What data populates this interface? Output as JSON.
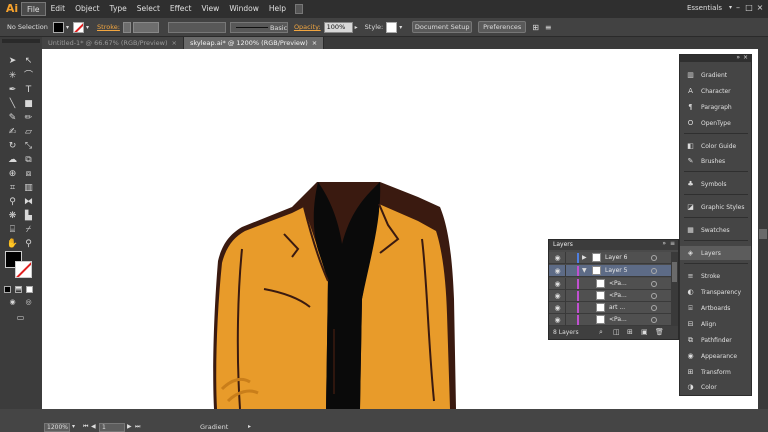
{
  "app": {
    "logo": "Ai"
  },
  "menu": [
    "File",
    "Edit",
    "Object",
    "Type",
    "Select",
    "Effect",
    "View",
    "Window",
    "Help"
  ],
  "workspace": {
    "label": "Essentials"
  },
  "control": {
    "selection": "No Selection",
    "stroke_label": "Stroke:",
    "profile": "Basic",
    "opacity_label": "Opacity:",
    "opacity_value": "100%",
    "style_label": "Style:",
    "doc_setup": "Document Setup",
    "preferences": "Preferences"
  },
  "tabs": [
    {
      "label": "Untitled-1* @ 66.67% (RGB/Preview)",
      "close": "×"
    },
    {
      "label": "skyleap.ai* @ 1200% (RGB/Preview)",
      "close": "×"
    }
  ],
  "status": {
    "zoom": "1200%",
    "page": "1",
    "tool": "Gradient"
  },
  "panels": [
    {
      "label": "Gradient",
      "icon": "gradient-icon"
    },
    {
      "label": "Character",
      "icon": "character-icon"
    },
    {
      "label": "Paragraph",
      "icon": "paragraph-icon"
    },
    {
      "label": "OpenType",
      "icon": "opentype-icon"
    },
    {
      "label": "Color Guide",
      "icon": "color-guide-icon"
    },
    {
      "label": "Brushes",
      "icon": "brushes-icon"
    },
    {
      "label": "Symbols",
      "icon": "symbols-icon"
    },
    {
      "label": "Graphic Styles",
      "icon": "graphic-styles-icon"
    },
    {
      "label": "Swatches",
      "icon": "swatches-icon"
    },
    {
      "label": "Layers",
      "icon": "layers-icon"
    },
    {
      "label": "Stroke",
      "icon": "stroke-icon"
    },
    {
      "label": "Transparency",
      "icon": "transparency-icon"
    },
    {
      "label": "Artboards",
      "icon": "artboards-icon"
    },
    {
      "label": "Align",
      "icon": "align-icon"
    },
    {
      "label": "Pathfinder",
      "icon": "pathfinder-icon"
    },
    {
      "label": "Appearance",
      "icon": "appearance-icon"
    },
    {
      "label": "Transform",
      "icon": "transform-icon"
    },
    {
      "label": "Color",
      "icon": "color-icon"
    }
  ],
  "layers": {
    "title": "Layers",
    "rows": [
      {
        "name": "Layer 6",
        "color": "#4f7fe0",
        "selected": false
      },
      {
        "name": "Layer 5",
        "color": "#c050d0",
        "selected": true
      },
      {
        "name": "<Pa...",
        "color": "#c050d0",
        "selected": false
      },
      {
        "name": "<Pa...",
        "color": "#c050d0",
        "selected": false
      },
      {
        "name": "art ...",
        "color": "#c050d0",
        "selected": false
      },
      {
        "name": "<Pa...",
        "color": "#c050d0",
        "selected": false
      }
    ],
    "count": "8 Layers"
  },
  "colors": {
    "jacket": "#e89b2a",
    "outline": "#3a1a10",
    "shirt": "#0a0a0a"
  }
}
